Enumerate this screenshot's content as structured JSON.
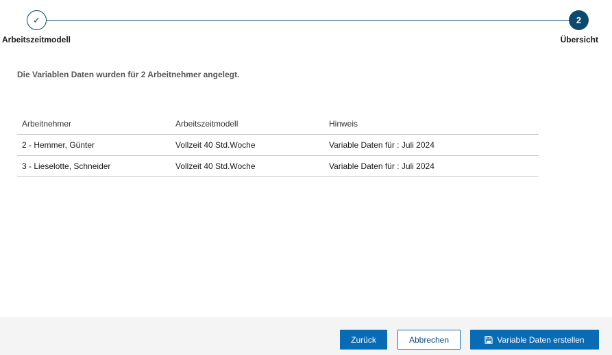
{
  "stepper": {
    "steps": [
      {
        "label": "Arbeitszeitmodell",
        "marker": "✓",
        "state": "completed"
      },
      {
        "label": "Übersicht",
        "marker": "2",
        "state": "active"
      }
    ]
  },
  "message": "Die Variablen Daten wurden für 2 Arbeitnehmer angelegt.",
  "table": {
    "headers": [
      "Arbeitnehmer",
      "Arbeitszeitmodell",
      "Hinweis"
    ],
    "rows": [
      [
        "2 - Hemmer, Günter",
        "Vollzeit 40 Std.Woche",
        "Variable Daten für : Juli 2024"
      ],
      [
        "3 - Lieselotte, Schneider",
        "Vollzeit 40 Std.Woche",
        "Variable Daten für : Juli 2024"
      ]
    ]
  },
  "footer": {
    "back_label": "Zurück",
    "cancel_label": "Abbrechen",
    "create_label": "Variable Daten erstellen",
    "create_icon": "save-icon"
  },
  "colors": {
    "primary": "#0a6bb5",
    "stepper": "#0b4a6e",
    "footer_bg": "#f4f4f4"
  }
}
